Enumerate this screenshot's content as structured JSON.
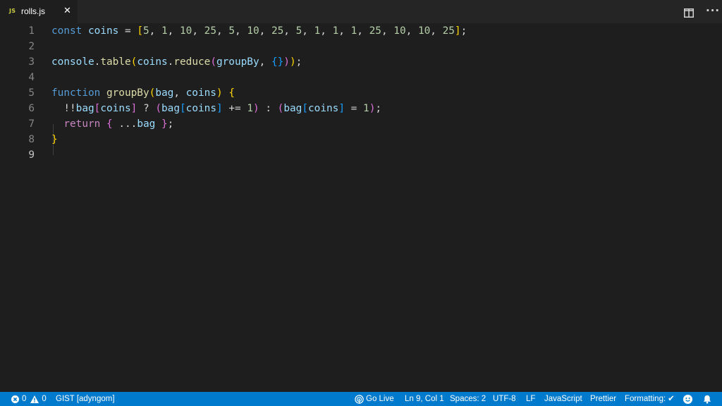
{
  "tab": {
    "lang_badge": "JS",
    "title": "rolls.js",
    "close_glyph": "✕"
  },
  "toolbar": {
    "more_glyph": "···"
  },
  "editor": {
    "line_numbers": [
      "1",
      "2",
      "3",
      "4",
      "5",
      "6",
      "7",
      "8",
      "9"
    ],
    "lines": [
      [
        {
          "t": "const",
          "c": "kw"
        },
        {
          "t": " ",
          "c": "op"
        },
        {
          "t": "coins",
          "c": "var"
        },
        {
          "t": " = ",
          "c": "op"
        },
        {
          "t": "[",
          "c": "b1"
        },
        {
          "t": "5",
          "c": "num"
        },
        {
          "t": ", ",
          "c": "op"
        },
        {
          "t": "1",
          "c": "num"
        },
        {
          "t": ", ",
          "c": "op"
        },
        {
          "t": "10",
          "c": "num"
        },
        {
          "t": ", ",
          "c": "op"
        },
        {
          "t": "25",
          "c": "num"
        },
        {
          "t": ", ",
          "c": "op"
        },
        {
          "t": "5",
          "c": "num"
        },
        {
          "t": ", ",
          "c": "op"
        },
        {
          "t": "10",
          "c": "num"
        },
        {
          "t": ", ",
          "c": "op"
        },
        {
          "t": "25",
          "c": "num"
        },
        {
          "t": ", ",
          "c": "op"
        },
        {
          "t": "5",
          "c": "num"
        },
        {
          "t": ", ",
          "c": "op"
        },
        {
          "t": "1",
          "c": "num"
        },
        {
          "t": ", ",
          "c": "op"
        },
        {
          "t": "1",
          "c": "num"
        },
        {
          "t": ", ",
          "c": "op"
        },
        {
          "t": "1",
          "c": "num"
        },
        {
          "t": ", ",
          "c": "op"
        },
        {
          "t": "25",
          "c": "num"
        },
        {
          "t": ", ",
          "c": "op"
        },
        {
          "t": "10",
          "c": "num"
        },
        {
          "t": ", ",
          "c": "op"
        },
        {
          "t": "10",
          "c": "num"
        },
        {
          "t": ", ",
          "c": "op"
        },
        {
          "t": "25",
          "c": "num"
        },
        {
          "t": "]",
          "c": "b1"
        },
        {
          "t": ";",
          "c": "op"
        }
      ],
      [],
      [
        {
          "t": "console",
          "c": "var"
        },
        {
          "t": ".",
          "c": "op"
        },
        {
          "t": "table",
          "c": "fn"
        },
        {
          "t": "(",
          "c": "b1"
        },
        {
          "t": "coins",
          "c": "var"
        },
        {
          "t": ".",
          "c": "op"
        },
        {
          "t": "reduce",
          "c": "fn"
        },
        {
          "t": "(",
          "c": "b2"
        },
        {
          "t": "groupBy",
          "c": "var"
        },
        {
          "t": ", ",
          "c": "op"
        },
        {
          "t": "{}",
          "c": "b3"
        },
        {
          "t": ")",
          "c": "b2"
        },
        {
          "t": ")",
          "c": "b1"
        },
        {
          "t": ";",
          "c": "op"
        }
      ],
      [],
      [
        {
          "t": "function",
          "c": "kw"
        },
        {
          "t": " ",
          "c": "op"
        },
        {
          "t": "groupBy",
          "c": "fn"
        },
        {
          "t": "(",
          "c": "b1"
        },
        {
          "t": "bag",
          "c": "var"
        },
        {
          "t": ", ",
          "c": "op"
        },
        {
          "t": "coins",
          "c": "var"
        },
        {
          "t": ")",
          "c": "b1"
        },
        {
          "t": " ",
          "c": "op"
        },
        {
          "t": "{",
          "c": "b1"
        }
      ],
      [
        {
          "t": "  !!",
          "c": "op"
        },
        {
          "t": "bag",
          "c": "var"
        },
        {
          "t": "[",
          "c": "b2"
        },
        {
          "t": "coins",
          "c": "var"
        },
        {
          "t": "]",
          "c": "b2"
        },
        {
          "t": " ? ",
          "c": "op"
        },
        {
          "t": "(",
          "c": "b2"
        },
        {
          "t": "bag",
          "c": "var"
        },
        {
          "t": "[",
          "c": "b3"
        },
        {
          "t": "coins",
          "c": "var"
        },
        {
          "t": "]",
          "c": "b3"
        },
        {
          "t": " += ",
          "c": "op"
        },
        {
          "t": "1",
          "c": "num"
        },
        {
          "t": ")",
          "c": "b2"
        },
        {
          "t": " : ",
          "c": "op"
        },
        {
          "t": "(",
          "c": "b2"
        },
        {
          "t": "bag",
          "c": "var"
        },
        {
          "t": "[",
          "c": "b3"
        },
        {
          "t": "coins",
          "c": "var"
        },
        {
          "t": "]",
          "c": "b3"
        },
        {
          "t": " = ",
          "c": "op"
        },
        {
          "t": "1",
          "c": "num"
        },
        {
          "t": ")",
          "c": "b2"
        },
        {
          "t": ";",
          "c": "op"
        }
      ],
      [
        {
          "t": "  ",
          "c": "op"
        },
        {
          "t": "return",
          "c": "ctl"
        },
        {
          "t": " ",
          "c": "op"
        },
        {
          "t": "{",
          "c": "b2"
        },
        {
          "t": " ...",
          "c": "op"
        },
        {
          "t": "bag",
          "c": "var"
        },
        {
          "t": " ",
          "c": "op"
        },
        {
          "t": "}",
          "c": "b2"
        },
        {
          "t": ";",
          "c": "op"
        }
      ],
      [
        {
          "t": "}",
          "c": "b1"
        }
      ],
      []
    ]
  },
  "statusbar": {
    "errors": "0",
    "warnings": "0",
    "gist": "GIST [adyngom]",
    "go_live": "Go Live",
    "cursor": "Ln 9, Col 1",
    "spaces": "Spaces: 2",
    "encoding": "UTF-8",
    "eol": "LF",
    "language": "JavaScript",
    "prettier": "Prettier",
    "formatting": "Formatting:",
    "formatting_check": "✔"
  },
  "colors": {
    "editor_bg": "#1e1e1e",
    "tabbar_bg": "#252526",
    "statusbar_bg": "#007acc",
    "keyword": "#569cd6",
    "variable": "#9cdcfe",
    "function": "#dcdcaa",
    "number": "#b5cea8",
    "bracket_1": "#ffd700",
    "bracket_2": "#da70d6",
    "bracket_3": "#179fff"
  }
}
